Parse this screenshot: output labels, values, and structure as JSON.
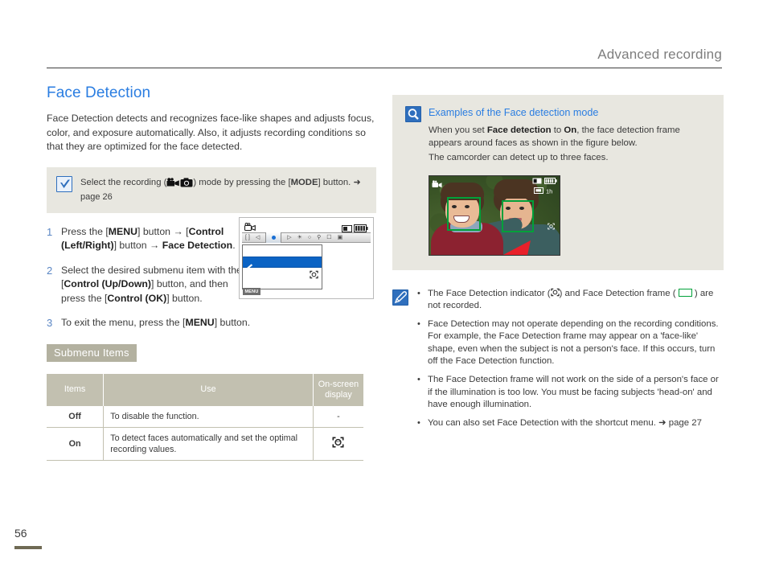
{
  "header": {
    "title": "Advanced recording"
  },
  "section": {
    "title": "Face Detection",
    "intro": "Face Detection detects and recognizes face-like shapes and adjusts focus, color, and exposure automatically. Also, it adjusts recording conditions so that they are optimized for the face detected."
  },
  "tip": {
    "icon": "check-icon",
    "text_before": "Select the recording (",
    "icon_video": "camcorder-icon",
    "icon_photo": "camera-icon",
    "text_after": ") mode by pressing the [",
    "mode_label": "MODE",
    "text_end": "] button.",
    "page_ref": "➜ page 26"
  },
  "steps": [
    {
      "num": "1",
      "parts": [
        {
          "t": "Press the [",
          "b": false
        },
        {
          "t": "MENU",
          "b": true
        },
        {
          "t": "] button → [",
          "b": false
        },
        {
          "t": "Control (Left/Right)",
          "b": true
        },
        {
          "t": "] button → ",
          "b": false
        },
        {
          "t": "Face Detection",
          "b": true
        },
        {
          "t": ".",
          "b": false
        }
      ]
    },
    {
      "num": "2",
      "parts": [
        {
          "t": "Select the desired submenu item with the [",
          "b": false
        },
        {
          "t": "Control (Up/Down)",
          "b": true
        },
        {
          "t": "] button, and then press the [",
          "b": false
        },
        {
          "t": "Control (OK)",
          "b": true
        },
        {
          "t": "] button.",
          "b": false
        }
      ]
    },
    {
      "num": "3",
      "parts": [
        {
          "t": "To exit the menu, press the [",
          "b": false
        },
        {
          "t": "MENU",
          "b": true
        },
        {
          "t": "] button.",
          "b": false
        }
      ]
    }
  ],
  "lcd": {
    "menu_button_label": "MENU",
    "tab_icons": [
      "brackets-icon",
      "left-chevron-icon",
      "blue-dot-icon",
      "right-chevron-icon",
      "palette-icon",
      "white-balance-icon",
      "magnifier-icon",
      "frame-icon",
      "display-icon"
    ],
    "selected_row_icon": "pen-icon",
    "second_row_icon": "face-detection-icon",
    "top_left_icon": "record-mode-icon",
    "battery_icon": "battery-icon"
  },
  "submenu": {
    "label": "Submenu Items",
    "columns": [
      "Items",
      "Use",
      "On-screen display"
    ],
    "rows": [
      {
        "item": "Off",
        "use": "To disable the function.",
        "osd": "-",
        "osd_icon": null
      },
      {
        "item": "On",
        "use": "To detect faces automatically and set the optimal recording values.",
        "osd": "",
        "osd_icon": "face-detection-icon"
      }
    ]
  },
  "examples": {
    "icon": "magnifier-icon",
    "title": "Examples of the Face detection mode",
    "body_parts": [
      {
        "t": "When you set ",
        "b": false
      },
      {
        "t": "Face detection",
        "b": true
      },
      {
        "t": " to ",
        "b": false
      },
      {
        "t": "On",
        "b": true
      },
      {
        "t": ", the face detection frame appears around faces as shown in the figure below.",
        "b": false
      }
    ],
    "body_line2": "The camcorder can detect up to three faces.",
    "photo_alt": "two boys with green face detection frames"
  },
  "notes": {
    "icon": "pen-icon",
    "items": [
      {
        "parts": [
          {
            "t": "The Face Detection indicator (",
            "b": false
          },
          {
            "t": "FD-ICON",
            "b": false,
            "icon": true
          },
          {
            "t": ") and Face Detection frame (",
            "b": false
          },
          {
            "t": "GREEN-BOX",
            "b": false,
            "box": true
          },
          {
            "t": ") are not recorded.",
            "b": false
          }
        ]
      },
      {
        "text": "Face Detection may not operate depending on the recording conditions. For example, the Face Detection frame may appear on a 'face-like' shape, even when the subject is not a person's face. If this occurs, turn off the Face Detection function."
      },
      {
        "text": "The Face Detection frame will not work on the side of a person's face or if the illumination is too low. You must be facing subjects 'head-on' and have enough illumination."
      },
      {
        "text": "You can also set Face Detection with the shortcut menu. ➜ page 27"
      }
    ]
  },
  "footer": {
    "page_number": "56"
  },
  "colors": {
    "accent_blue": "#2a7de1",
    "tip_bg": "#e8e7e0",
    "table_header": "#c2c0b0",
    "label_bg": "#b3b1a0",
    "frame_green": "#00a13a",
    "arrow_red": "#e8202a"
  }
}
